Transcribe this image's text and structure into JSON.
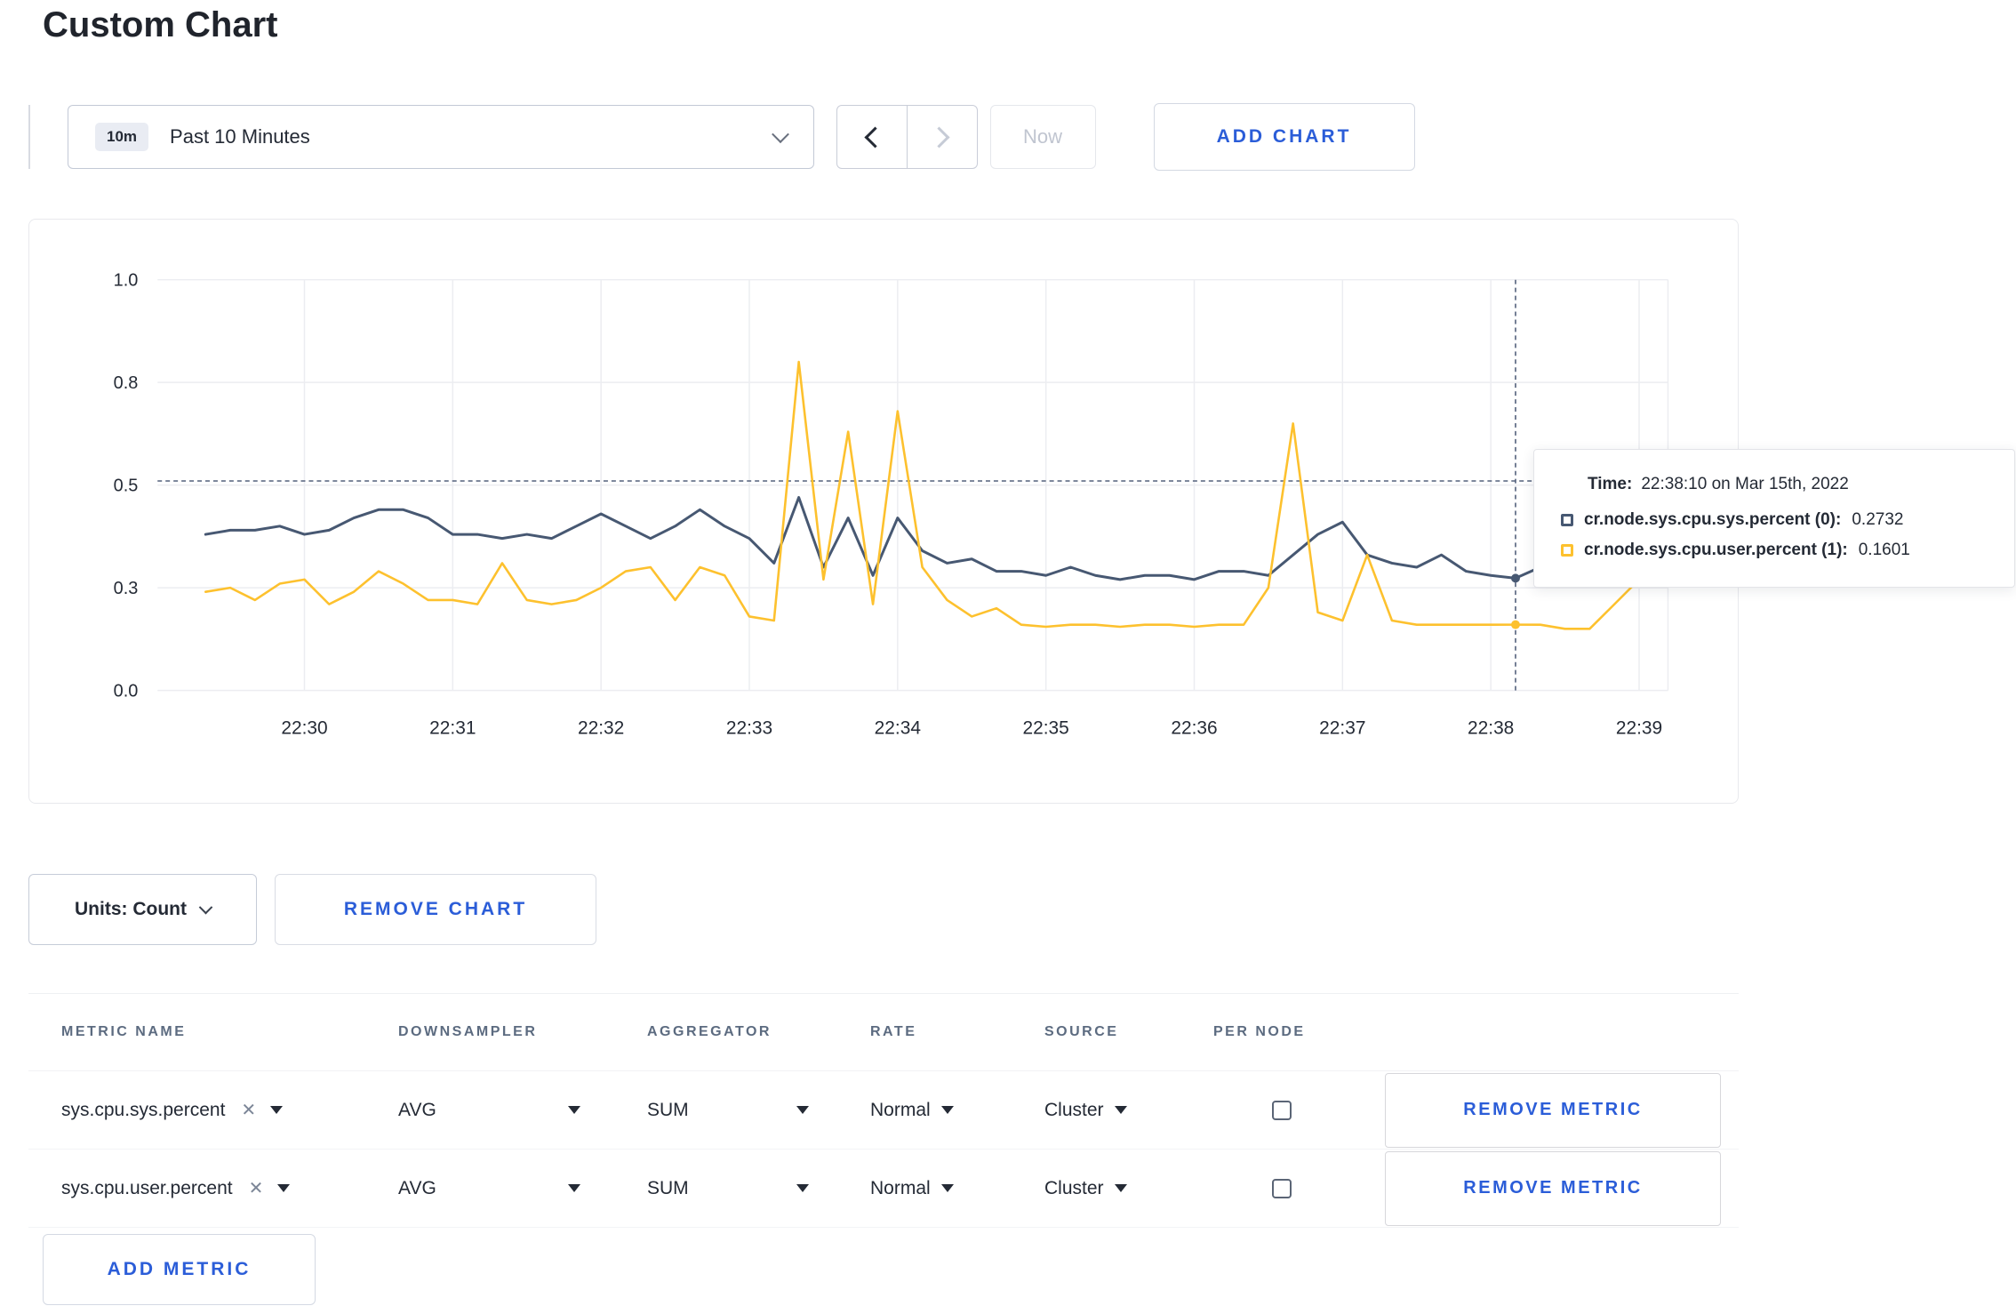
{
  "page": {
    "title": "Custom Chart"
  },
  "toolbar": {
    "range_badge": "10m",
    "range_label": "Past 10 Minutes",
    "now_label": "Now",
    "add_chart_label": "ADD CHART"
  },
  "chart": {
    "tooltip": {
      "time_label": "Time:",
      "time_value": "22:38:10 on Mar 15th, 2022",
      "series": [
        {
          "name": "cr.node.sys.cpu.sys.percent (0):",
          "value": "0.2732",
          "color": "#475872"
        },
        {
          "name": "cr.node.sys.cpu.user.percent (1):",
          "value": "0.1601",
          "color": "#fdc12e"
        }
      ]
    }
  },
  "chart_data": {
    "type": "line",
    "title": "",
    "xlabel": "",
    "ylabel": "",
    "ylim": [
      0,
      1
    ],
    "grid": true,
    "x_tick_labels": [
      "22:30",
      "22:31",
      "22:32",
      "22:33",
      "22:34",
      "22:35",
      "22:36",
      "22:37",
      "22:38",
      "22:39"
    ],
    "y_tick_values": [
      0,
      0.25,
      0.5,
      0.75,
      1.0
    ],
    "y_tick_labels": [
      "0.0",
      "0.3",
      "0.5",
      "0.8",
      "1.0"
    ],
    "sample_step_sec": 10,
    "first_sample_offset_sec": -40,
    "series": [
      {
        "name": "cr.node.sys.cpu.sys.percent",
        "color": "#475872",
        "values": [
          0.38,
          0.39,
          0.39,
          0.4,
          0.38,
          0.39,
          0.42,
          0.44,
          0.44,
          0.42,
          0.38,
          0.38,
          0.37,
          0.38,
          0.37,
          0.4,
          0.43,
          0.4,
          0.37,
          0.4,
          0.44,
          0.4,
          0.37,
          0.31,
          0.47,
          0.3,
          0.42,
          0.28,
          0.42,
          0.34,
          0.31,
          0.32,
          0.29,
          0.29,
          0.28,
          0.3,
          0.28,
          0.27,
          0.28,
          0.28,
          0.27,
          0.29,
          0.29,
          0.28,
          0.33,
          0.38,
          0.41,
          0.33,
          0.31,
          0.3,
          0.33,
          0.29,
          0.28,
          0.2732,
          0.3,
          0.32,
          0.3,
          0.3,
          0.31
        ]
      },
      {
        "name": "cr.node.sys.cpu.user.percent",
        "color": "#fdc12e",
        "values": [
          0.24,
          0.25,
          0.22,
          0.26,
          0.27,
          0.21,
          0.24,
          0.29,
          0.26,
          0.22,
          0.22,
          0.21,
          0.31,
          0.22,
          0.21,
          0.22,
          0.25,
          0.29,
          0.3,
          0.22,
          0.3,
          0.28,
          0.18,
          0.17,
          0.8,
          0.27,
          0.63,
          0.21,
          0.68,
          0.3,
          0.22,
          0.18,
          0.2,
          0.16,
          0.155,
          0.16,
          0.16,
          0.155,
          0.16,
          0.16,
          0.155,
          0.16,
          0.16,
          0.25,
          0.65,
          0.19,
          0.17,
          0.33,
          0.17,
          0.16,
          0.16,
          0.16,
          0.16,
          0.1601,
          0.16,
          0.15,
          0.15,
          0.21,
          0.27
        ]
      }
    ],
    "crosshair": {
      "time": "22:38:10",
      "x_offset_sec": 490,
      "hline_value": 0.51,
      "points": [
        0.2732,
        0.1601
      ]
    }
  },
  "units": {
    "label": "Units: Count",
    "remove_chart_label": "REMOVE CHART"
  },
  "metrics": {
    "headers": [
      "METRIC NAME",
      "DOWNSAMPLER",
      "AGGREGATOR",
      "RATE",
      "SOURCE",
      "PER NODE"
    ],
    "rows": [
      {
        "metric": "sys.cpu.sys.percent",
        "downsampler": "AVG",
        "aggregator": "SUM",
        "rate": "Normal",
        "source": "Cluster",
        "per_node": false,
        "remove_label": "REMOVE METRIC"
      },
      {
        "metric": "sys.cpu.user.percent",
        "downsampler": "AVG",
        "aggregator": "SUM",
        "rate": "Normal",
        "source": "Cluster",
        "per_node": false,
        "remove_label": "REMOVE METRIC"
      }
    ],
    "add_metric_label": "ADD METRIC"
  }
}
